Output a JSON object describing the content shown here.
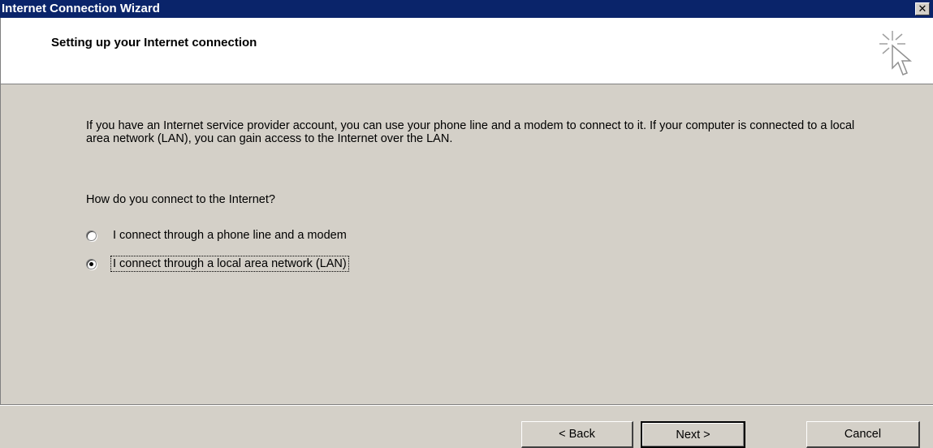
{
  "window": {
    "title": "Internet Connection Wizard",
    "close_glyph": "✕"
  },
  "header": {
    "title": "Setting up your Internet connection",
    "icon": "wizard-cursor-icon"
  },
  "content": {
    "intro": "If you have an Internet service provider account, you can use your phone line and a modem to connect to it. If your computer is connected to a local area network (LAN), you can gain access to the Internet over the LAN.",
    "question": "How do you connect to the Internet?",
    "options": [
      {
        "label": "I connect through a phone line and a modem",
        "checked": false
      },
      {
        "label": "I connect through a local area network (LAN)",
        "checked": true
      }
    ]
  },
  "buttons": {
    "back": "< Back",
    "next": "Next >",
    "cancel": "Cancel"
  },
  "colors": {
    "titlebar": "#0a246a",
    "dialog_bg": "#d4d0c8",
    "header_bg": "#ffffff"
  }
}
